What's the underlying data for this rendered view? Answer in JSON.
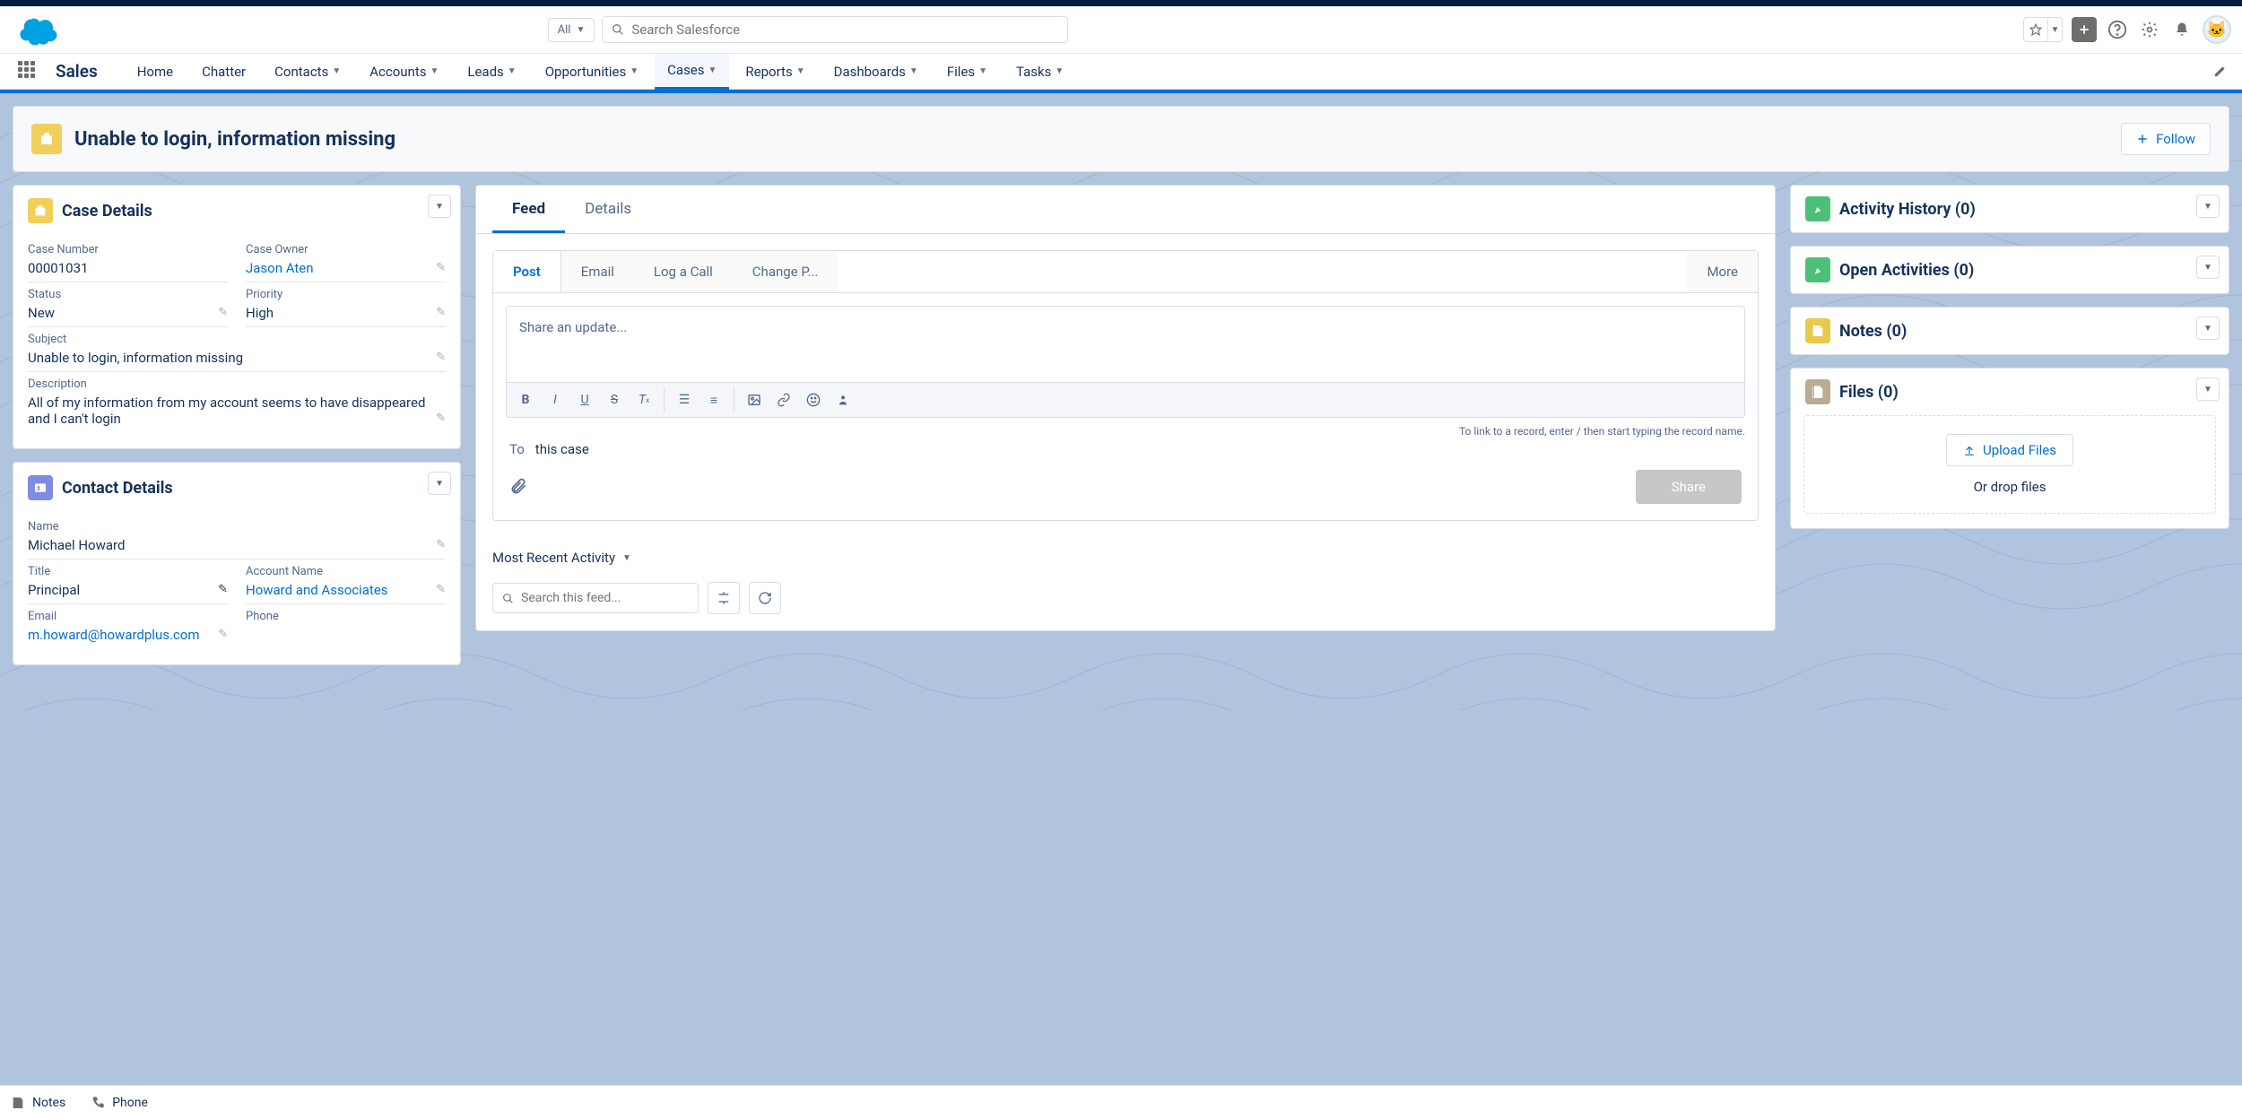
{
  "search": {
    "scope": "All",
    "placeholder": "Search Salesforce"
  },
  "app_name": "Sales",
  "nav": {
    "home": "Home",
    "chatter": "Chatter",
    "contacts": "Contacts",
    "accounts": "Accounts",
    "leads": "Leads",
    "opportunities": "Opportunities",
    "cases": "Cases",
    "reports": "Reports",
    "dashboards": "Dashboards",
    "files": "Files",
    "tasks": "Tasks"
  },
  "page_header": {
    "title": "Unable to login, information missing",
    "follow": "Follow"
  },
  "case_details": {
    "title": "Case Details",
    "case_number_label": "Case Number",
    "case_number": "00001031",
    "case_owner_label": "Case Owner",
    "case_owner": "Jason Aten",
    "status_label": "Status",
    "status": "New",
    "priority_label": "Priority",
    "priority": "High",
    "subject_label": "Subject",
    "subject": "Unable to login, information missing",
    "description_label": "Description",
    "description": "All of my information from my account seems to have disappeared and I can't login"
  },
  "contact_details": {
    "title": "Contact Details",
    "name_label": "Name",
    "name": "Michael Howard",
    "title_label": "Title",
    "title_value": "Principal",
    "account_label": "Account Name",
    "account": "Howard and Associates",
    "email_label": "Email",
    "email": "m.howard@howardplus.com",
    "phone_label": "Phone",
    "phone": ""
  },
  "feed": {
    "tabs": {
      "feed": "Feed",
      "details": "Details"
    },
    "pub_tabs": {
      "post": "Post",
      "email": "Email",
      "log_call": "Log a Call",
      "change_p": "Change P...",
      "more": "More"
    },
    "composer_placeholder": "Share an update...",
    "hint": "To link to a record, enter / then start typing the record name.",
    "to_label": "To",
    "to_value": "this case",
    "share": "Share",
    "sort": "Most Recent Activity",
    "search_placeholder": "Search this feed..."
  },
  "right": {
    "activity_history": "Activity History (0)",
    "open_activities": "Open Activities (0)",
    "notes": "Notes (0)",
    "files": "Files (0)",
    "upload": "Upload Files",
    "drop": "Or drop files"
  },
  "utility": {
    "notes": "Notes",
    "phone": "Phone"
  }
}
